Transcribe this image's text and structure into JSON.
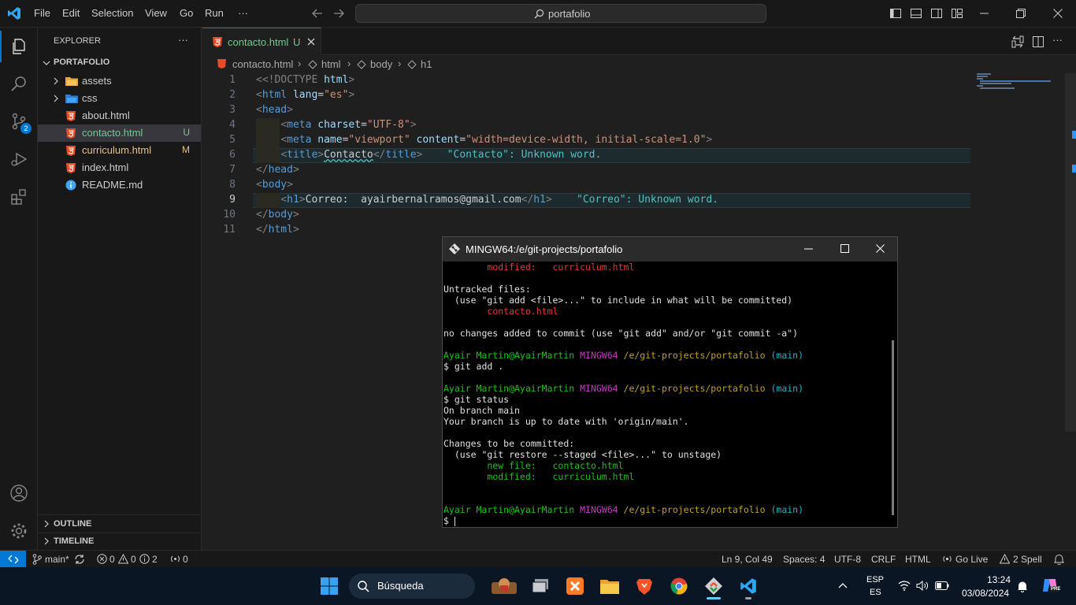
{
  "menu": [
    "File",
    "Edit",
    "Selection",
    "View",
    "Go",
    "Run",
    "···"
  ],
  "command_center": "portafolio",
  "sidebar": {
    "title": "EXPLORER",
    "more": "···",
    "root": "PORTAFOLIO",
    "items": [
      {
        "name": "assets",
        "type": "folder",
        "badge": ""
      },
      {
        "name": "css",
        "type": "folder",
        "badge": ""
      },
      {
        "name": "about.html",
        "type": "html",
        "badge": ""
      },
      {
        "name": "contacto.html",
        "type": "html",
        "badge": "U"
      },
      {
        "name": "curriculum.html",
        "type": "html",
        "badge": "M"
      },
      {
        "name": "index.html",
        "type": "html",
        "badge": ""
      },
      {
        "name": "README.md",
        "type": "md",
        "badge": ""
      }
    ],
    "outline": "OUTLINE",
    "timeline": "TIMELINE"
  },
  "tab": {
    "label": "contacto.html",
    "badge": "U"
  },
  "breadcrumb": [
    "contacto.html",
    "html",
    "body",
    "h1"
  ],
  "code": {
    "line_numbers": [
      "1",
      "2",
      "3",
      "4",
      "5",
      "6",
      "7",
      "8",
      "9",
      "10",
      "11"
    ],
    "l1_doctype": "<!DOCTYPE",
    "l1_html": "html",
    "l2_lang_val": "\"es\"",
    "l4_charset_val": "\"UTF-8\"",
    "l5_name_val": "\"viewport\"",
    "l5_content_val": "\"width=device-width, initial-scale=1.0\"",
    "l6_text": "Contacto",
    "l6_diag": "\"Contacto\": Unknown word.",
    "l9_text": "Correo:  ayairbernalramos@gmail.com",
    "l9_diag": "\"Correo\": Unknown word."
  },
  "terminal": {
    "title": "MINGW64:/e/git-projects/portafolio",
    "modified_label": "modified:",
    "new_file_label": "new file:",
    "curriculum": "curriculum.html",
    "contacto": "contacto.html",
    "untracked": "Untracked files:",
    "use_add": "  (use \"git add <file>...\" to include in what will be committed)",
    "no_changes": "no changes added to commit (use \"git add\" and/or \"git commit -a\")",
    "user": "Ayair Martin@AyairMartin",
    "env": "MINGW64",
    "path": "/e/git-projects/portafolio",
    "branch": "(main)",
    "cmd_add": "$ git add .",
    "cmd_status": "$ git status",
    "on_branch": "On branch main",
    "up_to_date": "Your branch is up to date with 'origin/main'.",
    "changes": "Changes to be committed:",
    "use_restore": "  (use \"git restore --staged <file>...\" to unstage)",
    "prompt": "$ "
  },
  "statusbar": {
    "branch": "main*",
    "errors": "0",
    "warnings": "0",
    "info": "2",
    "ports": "0",
    "position": "Ln 9, Col 49",
    "spaces": "Spaces: 4",
    "encoding": "UTF-8",
    "eol": "CRLF",
    "language": "HTML",
    "golive": "Go Live",
    "spell": "2 Spell"
  },
  "taskbar": {
    "search": "Búsqueda",
    "lang1": "ESP",
    "lang2": "ES",
    "time": "13:24",
    "date": "03/08/2024"
  },
  "colors": {
    "accent": "#0078d4",
    "untracked": "#73c991",
    "modified": "#e2c08d",
    "html_icon": "#e44d26"
  }
}
